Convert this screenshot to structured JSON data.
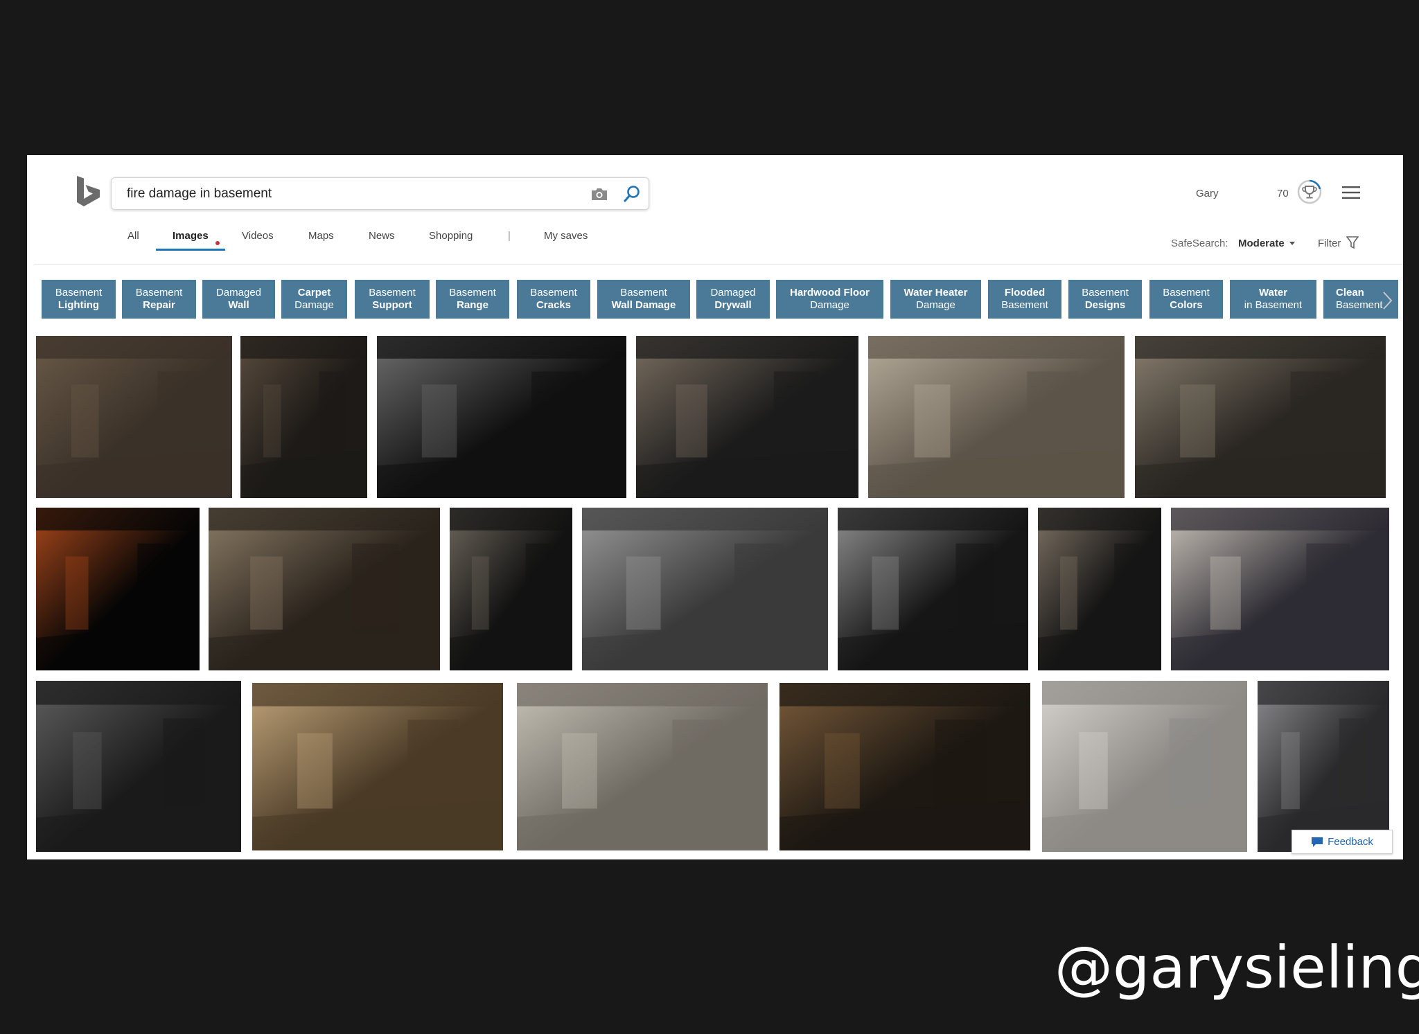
{
  "search": {
    "query": "fire damage in basement"
  },
  "header": {
    "user_name": "Gary",
    "rewards_points": "70"
  },
  "nav": {
    "tabs": [
      {
        "label": "All"
      },
      {
        "label": "Images"
      },
      {
        "label": "Videos"
      },
      {
        "label": "Maps"
      },
      {
        "label": "News"
      },
      {
        "label": "Shopping"
      },
      {
        "label": "|"
      },
      {
        "label": "My saves"
      }
    ],
    "safesearch_label": "SafeSearch:",
    "safesearch_value": "Moderate",
    "filter_label": "Filter"
  },
  "chips": [
    {
      "line1": "Basement",
      "line2": "Lighting",
      "bold": 2
    },
    {
      "line1": "Basement",
      "line2": "Repair",
      "bold": 2
    },
    {
      "line1": "Damaged",
      "line2": "Wall",
      "bold": 2
    },
    {
      "line1": "Carpet",
      "line2": "Damage",
      "bold": 1
    },
    {
      "line1": "Basement",
      "line2": "Support",
      "bold": 2
    },
    {
      "line1": "Basement",
      "line2": "Range",
      "bold": 2
    },
    {
      "line1": "Basement",
      "line2": "Cracks",
      "bold": 2
    },
    {
      "line1": "Basement",
      "line2": "Wall Damage",
      "bold": 2
    },
    {
      "line1": "Damaged",
      "line2": "Drywall",
      "bold": 2
    },
    {
      "line1": "Hardwood Floor",
      "line2": "Damage",
      "bold": 1
    },
    {
      "line1": "Water Heater",
      "line2": "Damage",
      "bold": 1
    },
    {
      "line1": "Flooded",
      "line2": "Basement",
      "bold": 1
    },
    {
      "line1": "Basement",
      "line2": "Designs",
      "bold": 2
    },
    {
      "line1": "Basement",
      "line2": "Colors",
      "bold": 2
    },
    {
      "line1": "Water",
      "line2": "in Basement",
      "bold": 1
    },
    {
      "line1": "Clean",
      "line2": "Basement",
      "bold": 1
    }
  ],
  "feedback_label": "Feedback",
  "slide_handle": "@garysieling",
  "colors": {
    "chip_bg": "#4b7a99",
    "tab_underline": "#1f73b7",
    "page_bg": "#181818"
  }
}
